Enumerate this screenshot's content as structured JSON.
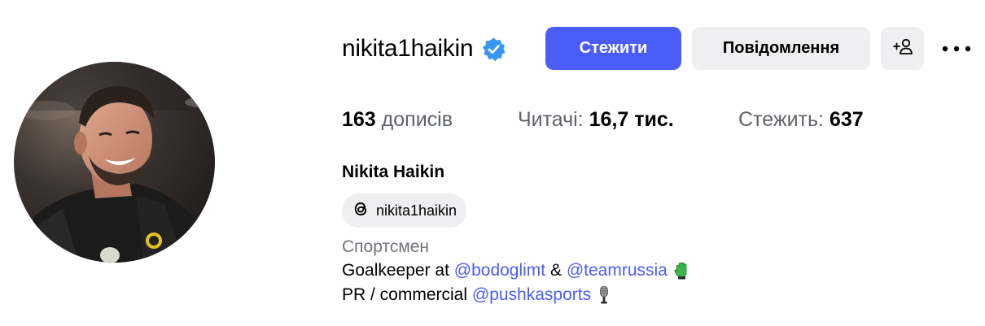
{
  "profile": {
    "username": "nikita1haikin",
    "verified": true,
    "full_name": "Nikita Haikin",
    "threads_handle": "nikita1haikin",
    "category": "Спортсмен"
  },
  "actions": {
    "follow_label": "Стежити",
    "message_label": "Повідомлення",
    "add_user_icon": "person-plus-icon",
    "more_icon": "more-horizontal-icon"
  },
  "stats": {
    "posts_count": "163",
    "posts_label": "дописів",
    "followers_label": "Читачі:",
    "followers_count": "16,7 тис.",
    "following_label": "Стежить:",
    "following_count": "637"
  },
  "bio": {
    "line1_prefix": "Goalkeeper at",
    "line1_mention1": "@bodoglimt",
    "line1_amp": "&",
    "line1_mention2": "@teamrussia",
    "line1_emoji": "green-glove-emoji",
    "line2_prefix": "PR / commercial",
    "line2_mention": "@pushkasports",
    "line2_emoji": "microphone-emoji"
  },
  "colors": {
    "accent": "#4a5df9",
    "verified_badge": "#3897f0",
    "button_gray": "#efeff1",
    "secondary_text": "#707379"
  }
}
